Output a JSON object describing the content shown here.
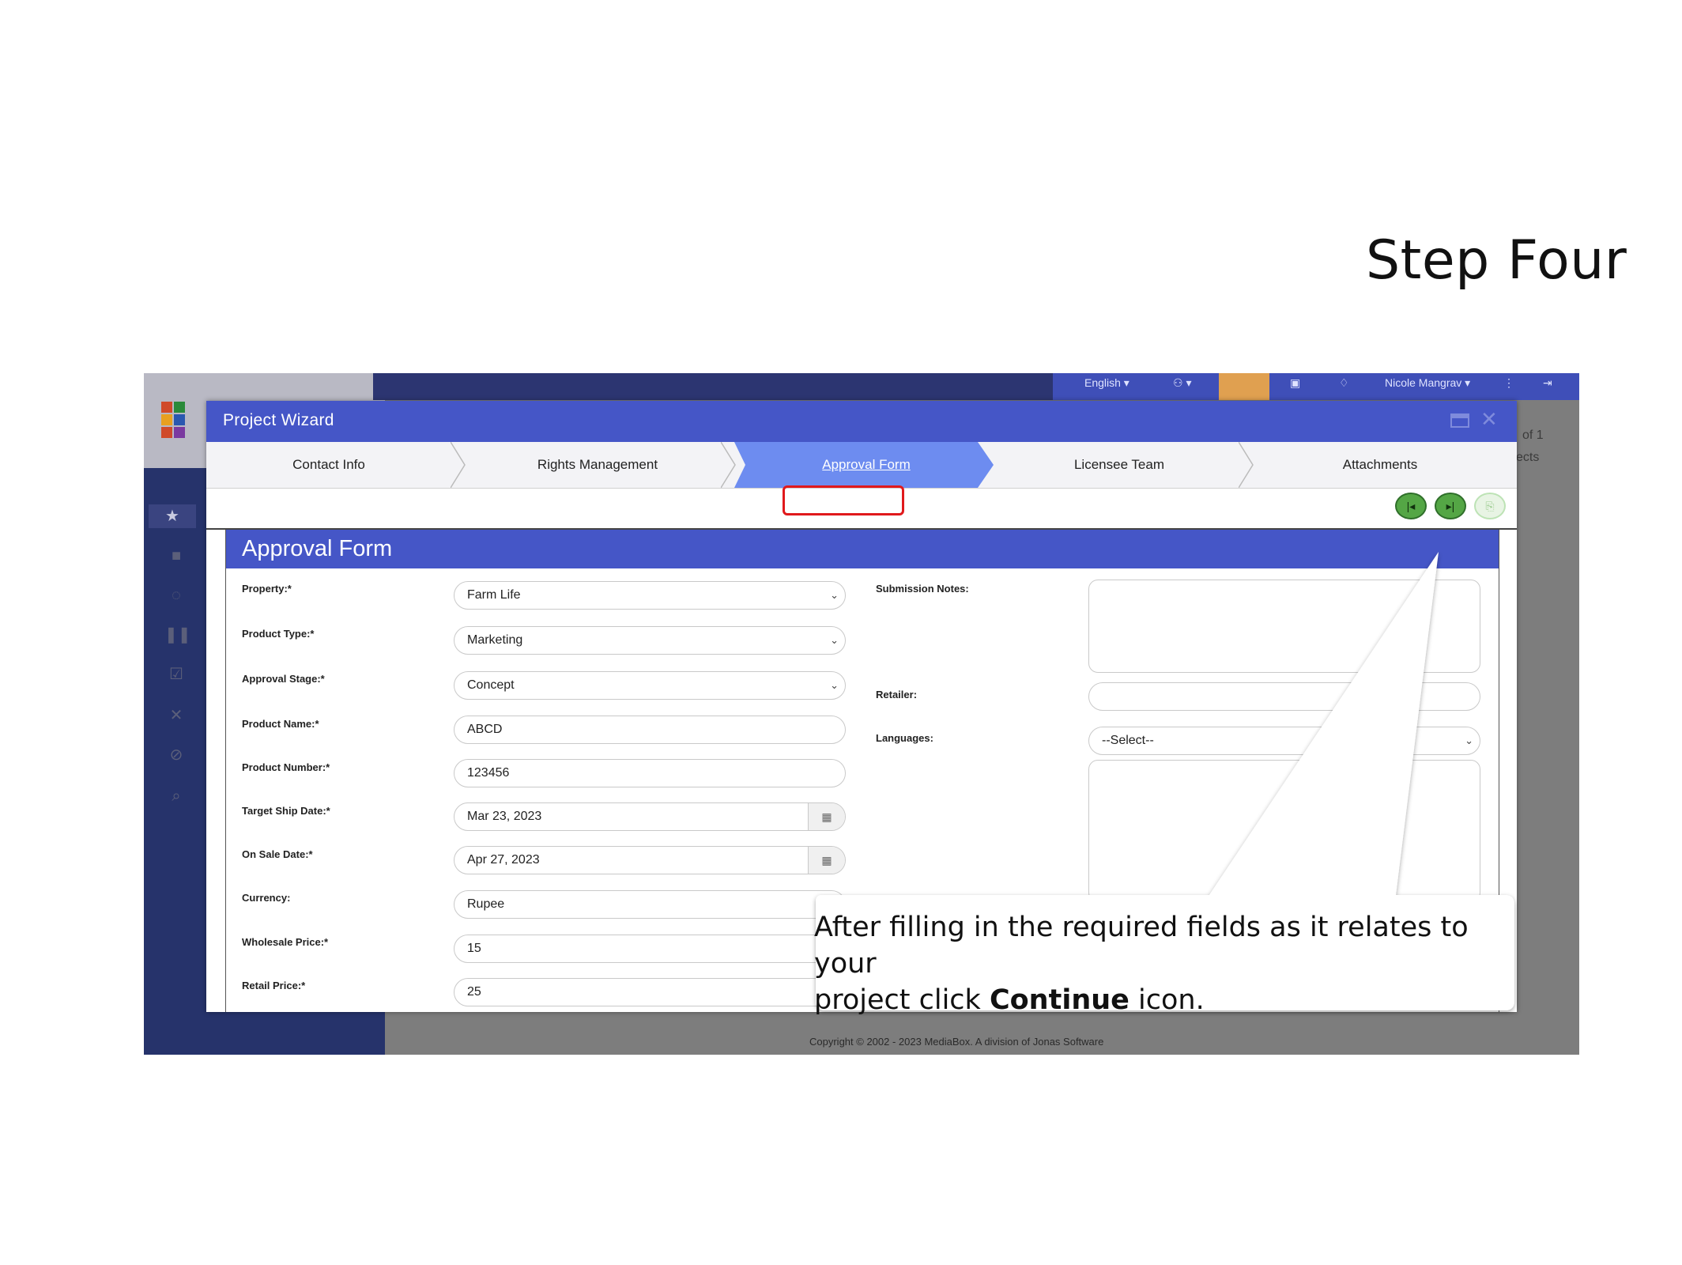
{
  "slide": {
    "step_title": "Step Four"
  },
  "topbar": {
    "language": "English ▾",
    "user": "Nicole Mangrav ▾"
  },
  "background_text": {
    "pager": "of 1",
    "projects_frag": "ects"
  },
  "footer": {
    "copyright": "Copyright © 2002 - 2023 MediaBox. A division of Jonas Software"
  },
  "wizard": {
    "title": "Project Wizard",
    "steps": [
      "Contact Info",
      "Rights Management",
      "Approval Form",
      "Licensee Team",
      "Attachments"
    ],
    "active_step": "Approval Form"
  },
  "form": {
    "title": "Approval Form",
    "left": [
      {
        "label": "Property:*",
        "value": "Farm Life",
        "type": "select"
      },
      {
        "label": "Product Type:*",
        "value": "Marketing",
        "type": "select"
      },
      {
        "label": "Approval Stage:*",
        "value": "Concept",
        "type": "select"
      },
      {
        "label": "Product Name:*",
        "value": "ABCD",
        "type": "text"
      },
      {
        "label": "Product Number:*",
        "value": "123456",
        "type": "text"
      },
      {
        "label": "Target Ship Date:*",
        "value": "Mar 23, 2023",
        "type": "date"
      },
      {
        "label": "On Sale Date:*",
        "value": "Apr 27, 2023",
        "type": "date"
      },
      {
        "label": "Currency:",
        "value": "Rupee",
        "type": "select"
      },
      {
        "label": "Wholesale Price:*",
        "value": "15",
        "type": "text"
      },
      {
        "label": "Retail Price:*",
        "value": "25",
        "type": "text"
      }
    ],
    "right": {
      "submission_notes_label": "Submission Notes:",
      "retailer_label": "Retailer:",
      "languages_label": "Languages:",
      "languages_value": "--Select--"
    }
  },
  "callout": {
    "line1": "After filling in the required fields as it relates to your",
    "line2_prefix": "project click ",
    "line2_bold": "Continue",
    "line2_suffix": " icon."
  },
  "colors": {
    "accent": "#4556c7",
    "active_step": "#6d8cf0",
    "highlight": "#e0191c",
    "button_green": "#54a645"
  }
}
